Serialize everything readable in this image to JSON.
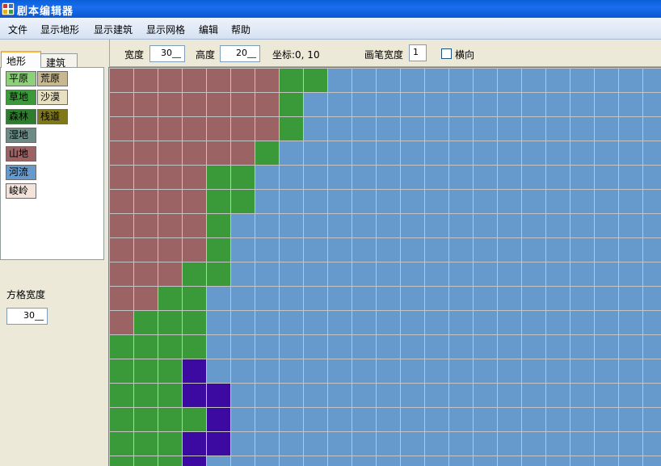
{
  "window": {
    "title": "剧本编辑器",
    "icon": "app-grid-icon"
  },
  "menu": [
    "文件",
    "显示地形",
    "显示建筑",
    "显示网格",
    "编辑",
    "帮助"
  ],
  "tabs": [
    {
      "label": "地形",
      "active": true
    },
    {
      "label": "建筑",
      "active": false
    }
  ],
  "terrain_types": [
    {
      "label": "平原",
      "color": "#8ed07a"
    },
    {
      "label": "荒原",
      "color": "#c8b890"
    },
    {
      "label": "草地",
      "color": "#3a9a3a"
    },
    {
      "label": "沙漠",
      "color": "#e8e0c0"
    },
    {
      "label": "森林",
      "color": "#2e7d2e"
    },
    {
      "label": "栈道",
      "color": "#807818"
    },
    {
      "label": "湿地",
      "color": "#6e8a84"
    },
    {
      "label": "山地",
      "color": "#9b6363"
    },
    {
      "label": "河流",
      "color": "#6699cc"
    },
    {
      "label": "峻岭",
      "color": "#f2e4da"
    }
  ],
  "cell_width": {
    "label": "方格宽度",
    "value": "30__"
  },
  "toolbar": {
    "width_label": "宽度",
    "width_value": "30__",
    "height_label": "高度",
    "height_value": "20__",
    "coord_text": "坐标:0, 10",
    "brush_label": "画笔宽度",
    "brush_value": "1",
    "horizontal_label": "横向",
    "horizontal_checked": false
  },
  "map": {
    "legend": {
      "M": "山地",
      "G": "草地",
      "R": "河流",
      "P": "紫色地块"
    },
    "colors": {
      "M": "#9b6363",
      "G": "#3a9a3a",
      "R": "#6699cc",
      "P": "#3c0aa0",
      "grid": "#c4c4c4"
    },
    "rows": [
      "MMMMMMMGGRRRRRRRRRRRRRRRRR",
      "MMMMMMMGRRRRRRRRRRRRRRRRRR",
      "MMMMMMMGRRRRRRRRRRRRRRRRRR",
      "MMMMMMGRRRRRRRRRRRRRRRRRRR",
      "MMMMGGRRRRRRRRRRRRRRRRRRRR",
      "MMMMGGRRRRRRRRRRRRRRRRRRRR",
      "MMMMGRRRRRRRRRRRRRRRRRRRRR",
      "MMMMGRRRRRRRRRRRRRRRRRRRRR",
      "MMMGGRRRRRRRRRRRRRRRRRRRRR",
      "MMGGRRRRRRRRRRRRRRRRRRRRRR",
      "MGGGRRRRRRRRRRRRRRRRRRRRRR",
      "GGGGRRRRRRRRRRRRRRRRRRRRRR",
      "GGGPRRRRRRRRRRRRRRRRRRRRRR",
      "GGGPPRRRRRRRRRRRRRRRRRRRRR",
      "GGGGPRRRRRRRRRRRRRRRRRRRRR",
      "GGGPPRRRRRRRRRRRRRRRRRRRRR",
      "GGGPRRRRRRRRRRRRRRRRRRRRRR"
    ]
  }
}
